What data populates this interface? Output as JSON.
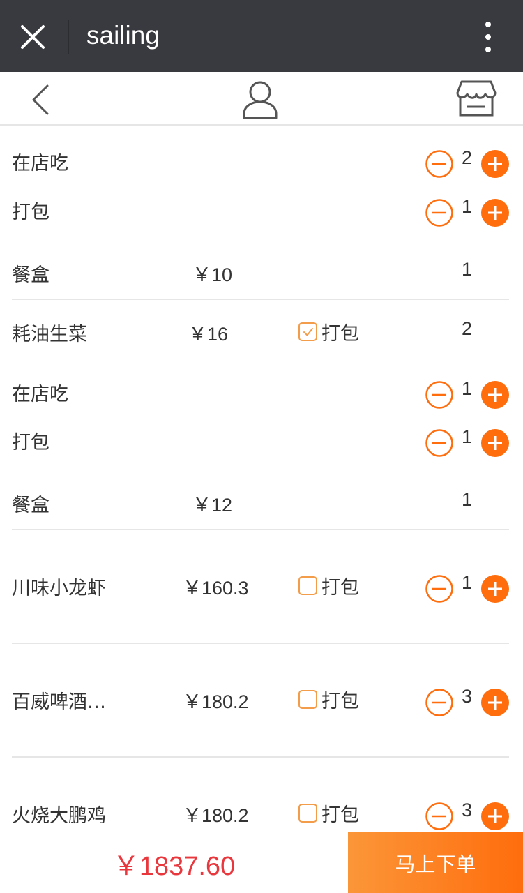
{
  "titlebar": {
    "title": "sailing"
  },
  "currency": "￥",
  "group1": {
    "dine_in_label": "在店吃",
    "dine_in_qty": "2",
    "takeaway_label": "打包",
    "takeaway_qty": "1",
    "box_label": "餐盒",
    "box_price": "￥10",
    "box_qty": "1"
  },
  "item_lettuce": {
    "name": "耗油生菜",
    "price": "￥16",
    "pack_label": "打包",
    "pack_checked": true,
    "qty": "2"
  },
  "group2": {
    "dine_in_label": "在店吃",
    "dine_in_qty": "1",
    "takeaway_label": "打包",
    "takeaway_qty": "1",
    "box_label": "餐盒",
    "box_price": "￥12",
    "box_qty": "1"
  },
  "item_crayfish": {
    "name": "川味小龙虾",
    "price": "￥160.3",
    "pack_label": "打包",
    "pack_checked": false,
    "qty": "1"
  },
  "item_beer": {
    "name": "百威啤酒…",
    "price": "￥180.2",
    "pack_label": "打包",
    "pack_checked": false,
    "qty": "3"
  },
  "item_chicken": {
    "name": "火烧大鹏鸡",
    "price": "￥180.2",
    "pack_label": "打包",
    "pack_checked": false,
    "qty": "3"
  },
  "footer": {
    "total": "￥1837.60",
    "order_label": "马上下单"
  },
  "colors": {
    "accent": "#ff6d0d",
    "accent_light": "#fb9638",
    "total_red": "#e8373d",
    "titlebar": "#393a3f"
  },
  "icons": [
    "close-icon",
    "more-vertical-icon",
    "back-chevron-icon",
    "user-icon",
    "store-icon",
    "minus-circle-icon",
    "plus-circle-icon",
    "checkbox-icon"
  ]
}
